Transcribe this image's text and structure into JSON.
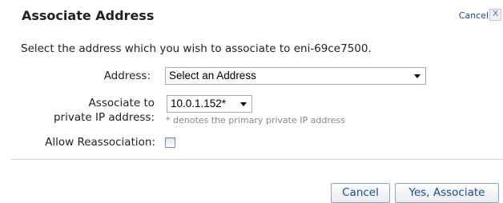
{
  "dialog": {
    "title": "Associate Address",
    "cancel_link": "Cancel",
    "close_glyph": "X",
    "intro": "Select the address which you wish to associate to eni-69ce7500."
  },
  "form": {
    "address_label": "Address:",
    "address_value": "Select an Address",
    "private_ip_label_line1": "Associate to",
    "private_ip_label_line2": "private IP address:",
    "private_ip_value": "10.0.1.152*",
    "private_ip_hint": "* denotes the primary private IP address",
    "reassociation_label": "Allow Reassociation:",
    "reassociation_checked": false
  },
  "buttons": {
    "cancel": "Cancel",
    "confirm": "Yes, Associate"
  },
  "icons": {
    "close": "close-icon",
    "dropdown": "chevron-down-icon"
  }
}
